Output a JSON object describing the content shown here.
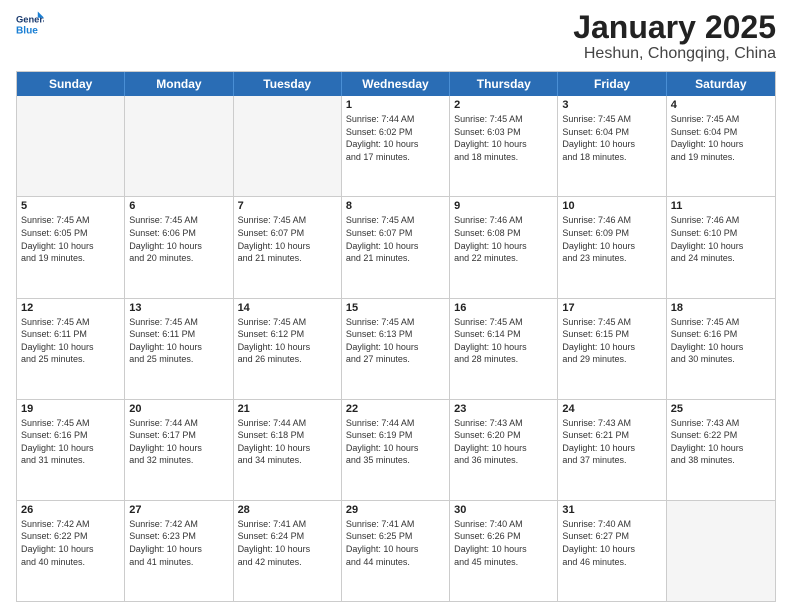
{
  "header": {
    "logo_general": "General",
    "logo_blue": "Blue",
    "month_title": "January 2025",
    "location": "Heshun, Chongqing, China"
  },
  "weekdays": [
    "Sunday",
    "Monday",
    "Tuesday",
    "Wednesday",
    "Thursday",
    "Friday",
    "Saturday"
  ],
  "rows": [
    [
      {
        "day": "",
        "info": "",
        "empty": true
      },
      {
        "day": "",
        "info": "",
        "empty": true
      },
      {
        "day": "",
        "info": "",
        "empty": true
      },
      {
        "day": "1",
        "info": "Sunrise: 7:44 AM\nSunset: 6:02 PM\nDaylight: 10 hours\nand 17 minutes.",
        "empty": false
      },
      {
        "day": "2",
        "info": "Sunrise: 7:45 AM\nSunset: 6:03 PM\nDaylight: 10 hours\nand 18 minutes.",
        "empty": false
      },
      {
        "day": "3",
        "info": "Sunrise: 7:45 AM\nSunset: 6:04 PM\nDaylight: 10 hours\nand 18 minutes.",
        "empty": false
      },
      {
        "day": "4",
        "info": "Sunrise: 7:45 AM\nSunset: 6:04 PM\nDaylight: 10 hours\nand 19 minutes.",
        "empty": false
      }
    ],
    [
      {
        "day": "5",
        "info": "Sunrise: 7:45 AM\nSunset: 6:05 PM\nDaylight: 10 hours\nand 19 minutes.",
        "empty": false
      },
      {
        "day": "6",
        "info": "Sunrise: 7:45 AM\nSunset: 6:06 PM\nDaylight: 10 hours\nand 20 minutes.",
        "empty": false
      },
      {
        "day": "7",
        "info": "Sunrise: 7:45 AM\nSunset: 6:07 PM\nDaylight: 10 hours\nand 21 minutes.",
        "empty": false
      },
      {
        "day": "8",
        "info": "Sunrise: 7:45 AM\nSunset: 6:07 PM\nDaylight: 10 hours\nand 21 minutes.",
        "empty": false
      },
      {
        "day": "9",
        "info": "Sunrise: 7:46 AM\nSunset: 6:08 PM\nDaylight: 10 hours\nand 22 minutes.",
        "empty": false
      },
      {
        "day": "10",
        "info": "Sunrise: 7:46 AM\nSunset: 6:09 PM\nDaylight: 10 hours\nand 23 minutes.",
        "empty": false
      },
      {
        "day": "11",
        "info": "Sunrise: 7:46 AM\nSunset: 6:10 PM\nDaylight: 10 hours\nand 24 minutes.",
        "empty": false
      }
    ],
    [
      {
        "day": "12",
        "info": "Sunrise: 7:45 AM\nSunset: 6:11 PM\nDaylight: 10 hours\nand 25 minutes.",
        "empty": false
      },
      {
        "day": "13",
        "info": "Sunrise: 7:45 AM\nSunset: 6:11 PM\nDaylight: 10 hours\nand 25 minutes.",
        "empty": false
      },
      {
        "day": "14",
        "info": "Sunrise: 7:45 AM\nSunset: 6:12 PM\nDaylight: 10 hours\nand 26 minutes.",
        "empty": false
      },
      {
        "day": "15",
        "info": "Sunrise: 7:45 AM\nSunset: 6:13 PM\nDaylight: 10 hours\nand 27 minutes.",
        "empty": false
      },
      {
        "day": "16",
        "info": "Sunrise: 7:45 AM\nSunset: 6:14 PM\nDaylight: 10 hours\nand 28 minutes.",
        "empty": false
      },
      {
        "day": "17",
        "info": "Sunrise: 7:45 AM\nSunset: 6:15 PM\nDaylight: 10 hours\nand 29 minutes.",
        "empty": false
      },
      {
        "day": "18",
        "info": "Sunrise: 7:45 AM\nSunset: 6:16 PM\nDaylight: 10 hours\nand 30 minutes.",
        "empty": false
      }
    ],
    [
      {
        "day": "19",
        "info": "Sunrise: 7:45 AM\nSunset: 6:16 PM\nDaylight: 10 hours\nand 31 minutes.",
        "empty": false
      },
      {
        "day": "20",
        "info": "Sunrise: 7:44 AM\nSunset: 6:17 PM\nDaylight: 10 hours\nand 32 minutes.",
        "empty": false
      },
      {
        "day": "21",
        "info": "Sunrise: 7:44 AM\nSunset: 6:18 PM\nDaylight: 10 hours\nand 34 minutes.",
        "empty": false
      },
      {
        "day": "22",
        "info": "Sunrise: 7:44 AM\nSunset: 6:19 PM\nDaylight: 10 hours\nand 35 minutes.",
        "empty": false
      },
      {
        "day": "23",
        "info": "Sunrise: 7:43 AM\nSunset: 6:20 PM\nDaylight: 10 hours\nand 36 minutes.",
        "empty": false
      },
      {
        "day": "24",
        "info": "Sunrise: 7:43 AM\nSunset: 6:21 PM\nDaylight: 10 hours\nand 37 minutes.",
        "empty": false
      },
      {
        "day": "25",
        "info": "Sunrise: 7:43 AM\nSunset: 6:22 PM\nDaylight: 10 hours\nand 38 minutes.",
        "empty": false
      }
    ],
    [
      {
        "day": "26",
        "info": "Sunrise: 7:42 AM\nSunset: 6:22 PM\nDaylight: 10 hours\nand 40 minutes.",
        "empty": false
      },
      {
        "day": "27",
        "info": "Sunrise: 7:42 AM\nSunset: 6:23 PM\nDaylight: 10 hours\nand 41 minutes.",
        "empty": false
      },
      {
        "day": "28",
        "info": "Sunrise: 7:41 AM\nSunset: 6:24 PM\nDaylight: 10 hours\nand 42 minutes.",
        "empty": false
      },
      {
        "day": "29",
        "info": "Sunrise: 7:41 AM\nSunset: 6:25 PM\nDaylight: 10 hours\nand 44 minutes.",
        "empty": false
      },
      {
        "day": "30",
        "info": "Sunrise: 7:40 AM\nSunset: 6:26 PM\nDaylight: 10 hours\nand 45 minutes.",
        "empty": false
      },
      {
        "day": "31",
        "info": "Sunrise: 7:40 AM\nSunset: 6:27 PM\nDaylight: 10 hours\nand 46 minutes.",
        "empty": false
      },
      {
        "day": "",
        "info": "",
        "empty": true
      }
    ]
  ]
}
